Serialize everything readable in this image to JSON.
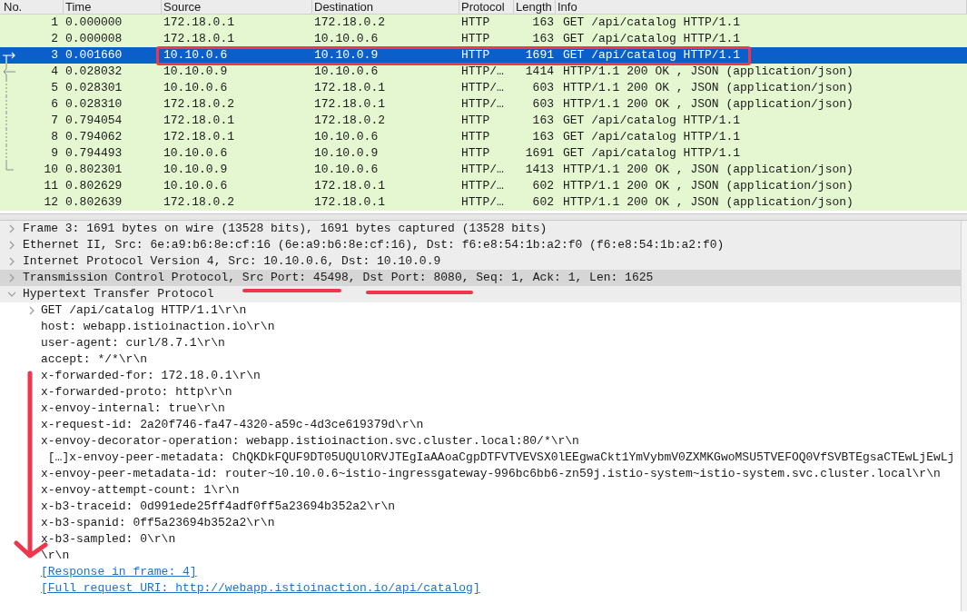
{
  "packet_list": {
    "columns": [
      "No.",
      "Time",
      "Source",
      "Destination",
      "Protocol",
      "Length",
      "Info"
    ],
    "rows": [
      {
        "kind": "plain",
        "no": "1",
        "time": "0.000000",
        "source": "172.18.0.1",
        "destination": "172.18.0.2",
        "protocol": "HTTP",
        "length": "163",
        "info": "GET /api/catalog HTTP/1.1",
        "selected": false
      },
      {
        "kind": "plain",
        "no": "2",
        "time": "0.000008",
        "source": "172.18.0.1",
        "destination": "10.10.0.6",
        "protocol": "HTTP",
        "length": "163",
        "info": "GET /api/catalog HTTP/1.1",
        "selected": false
      },
      {
        "kind": "request",
        "no": "3",
        "time": "0.001660",
        "source": "10.10.0.6",
        "destination": "10.10.0.9",
        "protocol": "HTTP",
        "length": "1691",
        "info": "GET /api/catalog HTTP/1.1",
        "selected": true
      },
      {
        "kind": "response",
        "no": "4",
        "time": "0.028032",
        "source": "10.10.0.9",
        "destination": "10.10.0.6",
        "protocol": "HTTP/…",
        "length": "1414",
        "info": "HTTP/1.1 200 OK , JSON (application/json)",
        "selected": false
      },
      {
        "kind": "span",
        "no": "5",
        "time": "0.028301",
        "source": "10.10.0.6",
        "destination": "172.18.0.1",
        "protocol": "HTTP/…",
        "length": "603",
        "info": "HTTP/1.1 200 OK , JSON (application/json)",
        "selected": false
      },
      {
        "kind": "span",
        "no": "6",
        "time": "0.028310",
        "source": "172.18.0.2",
        "destination": "172.18.0.1",
        "protocol": "HTTP/…",
        "length": "603",
        "info": "HTTP/1.1 200 OK , JSON (application/json)",
        "selected": false
      },
      {
        "kind": "span",
        "no": "7",
        "time": "0.794054",
        "source": "172.18.0.1",
        "destination": "172.18.0.2",
        "protocol": "HTTP",
        "length": "163",
        "info": "GET /api/catalog HTTP/1.1",
        "selected": false
      },
      {
        "kind": "span",
        "no": "8",
        "time": "0.794062",
        "source": "172.18.0.1",
        "destination": "10.10.0.6",
        "protocol": "HTTP",
        "length": "163",
        "info": "GET /api/catalog HTTP/1.1",
        "selected": false
      },
      {
        "kind": "span",
        "no": "9",
        "time": "0.794493",
        "source": "10.10.0.6",
        "destination": "10.10.0.9",
        "protocol": "HTTP",
        "length": "1691",
        "info": "GET /api/catalog HTTP/1.1",
        "selected": false
      },
      {
        "kind": "end",
        "no": "10",
        "time": "0.802301",
        "source": "10.10.0.9",
        "destination": "10.10.0.6",
        "protocol": "HTTP/…",
        "length": "1413",
        "info": "HTTP/1.1 200 OK , JSON (application/json)",
        "selected": false
      },
      {
        "kind": "plain",
        "no": "11",
        "time": "0.802629",
        "source": "10.10.0.6",
        "destination": "172.18.0.1",
        "protocol": "HTTP/…",
        "length": "602",
        "info": "HTTP/1.1 200 OK , JSON (application/json)",
        "selected": false
      },
      {
        "kind": "plain",
        "no": "12",
        "time": "0.802639",
        "source": "172.18.0.2",
        "destination": "172.18.0.1",
        "protocol": "HTTP/…",
        "length": "602",
        "info": "HTTP/1.1 200 OK , JSON (application/json)",
        "selected": false
      }
    ]
  },
  "details": [
    {
      "text": "Frame 3: 1691 bytes on wire (13528 bits), 1691 bytes captured (13528 bits)",
      "expanded": false,
      "selected": false
    },
    {
      "text": "Ethernet II, Src: 6e:a9:b6:8e:cf:16 (6e:a9:b6:8e:cf:16), Dst: f6:e8:54:1b:a2:f0 (f6:e8:54:1b:a2:f0)",
      "expanded": false,
      "selected": false
    },
    {
      "text": "Internet Protocol Version 4, Src: 10.10.0.6, Dst: 10.10.0.9",
      "expanded": false,
      "selected": false
    },
    {
      "text": "Transmission Control Protocol, Src Port: 45498, Dst Port: 8080, Seq: 1, Ack: 1, Len: 1625",
      "expanded": false,
      "selected": true
    },
    {
      "text": "Hypertext Transfer Protocol",
      "expanded": true,
      "selected": false,
      "children": [
        {
          "kind": "node",
          "text": "GET /api/catalog HTTP/1.1\\r\\n",
          "expanded": false
        },
        {
          "kind": "field",
          "text": "host: webapp.istioinaction.io\\r\\n"
        },
        {
          "kind": "field",
          "text": "user-agent: curl/8.7.1\\r\\n"
        },
        {
          "kind": "field",
          "text": "accept: */*\\r\\n"
        },
        {
          "kind": "field",
          "text": "x-forwarded-for: 172.18.0.1\\r\\n"
        },
        {
          "kind": "field",
          "text": "x-forwarded-proto: http\\r\\n"
        },
        {
          "kind": "field",
          "text": "x-envoy-internal: true\\r\\n"
        },
        {
          "kind": "field",
          "text": "x-request-id: 2a20f746-fa47-4320-a59c-4d3ce619379d\\r\\n"
        },
        {
          "kind": "field",
          "text": "x-envoy-decorator-operation: webapp.istioinaction.svc.cluster.local:80/*\\r\\n"
        },
        {
          "kind": "field",
          "text": " […]x-envoy-peer-metadata: ChQKDkFQUF9DT05UQUlORVJTEgIaAAoaCgpDTFVTVEVSX0lEEgwaCkt1YmVybmV0ZXMKGwoMSU5TVEFOQ0VfSVBTEgsaCTEwLjEwLj"
        },
        {
          "kind": "field",
          "text": "x-envoy-peer-metadata-id: router~10.10.0.6~istio-ingressgateway-996bc6bb6-zn59j.istio-system~istio-system.svc.cluster.local\\r\\n"
        },
        {
          "kind": "field",
          "text": "x-envoy-attempt-count: 1\\r\\n"
        },
        {
          "kind": "field",
          "text": "x-b3-traceid: 0d991ede25ff4adf0ff5a23694b352a2\\r\\n"
        },
        {
          "kind": "field",
          "text": "x-b3-spanid: 0ff5a23694b352a2\\r\\n"
        },
        {
          "kind": "field",
          "text": "x-b3-sampled: 0\\r\\n"
        },
        {
          "kind": "field",
          "text": "\\r\\n"
        },
        {
          "kind": "link",
          "text": "[Response in frame: 4]"
        },
        {
          "kind": "link",
          "text": "[Full request URI: http://webapp.istioinaction.io/api/catalog]"
        }
      ]
    }
  ]
}
